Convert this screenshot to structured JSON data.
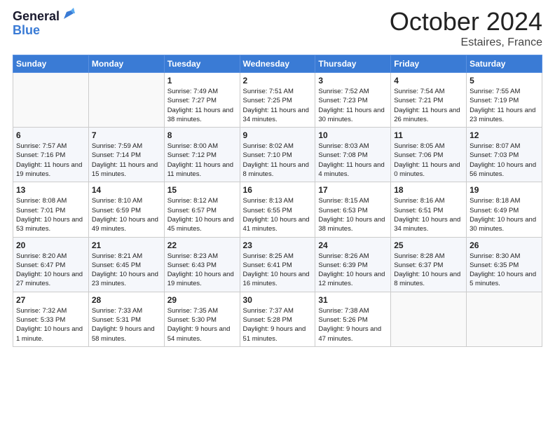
{
  "logo": {
    "general": "General",
    "blue": "Blue"
  },
  "header": {
    "month": "October 2024",
    "location": "Estaires, France"
  },
  "weekdays": [
    "Sunday",
    "Monday",
    "Tuesday",
    "Wednesday",
    "Thursday",
    "Friday",
    "Saturday"
  ],
  "weeks": [
    [
      {
        "day": "",
        "sunrise": "",
        "sunset": "",
        "daylight": ""
      },
      {
        "day": "",
        "sunrise": "",
        "sunset": "",
        "daylight": ""
      },
      {
        "day": "1",
        "sunrise": "Sunrise: 7:49 AM",
        "sunset": "Sunset: 7:27 PM",
        "daylight": "Daylight: 11 hours and 38 minutes."
      },
      {
        "day": "2",
        "sunrise": "Sunrise: 7:51 AM",
        "sunset": "Sunset: 7:25 PM",
        "daylight": "Daylight: 11 hours and 34 minutes."
      },
      {
        "day": "3",
        "sunrise": "Sunrise: 7:52 AM",
        "sunset": "Sunset: 7:23 PM",
        "daylight": "Daylight: 11 hours and 30 minutes."
      },
      {
        "day": "4",
        "sunrise": "Sunrise: 7:54 AM",
        "sunset": "Sunset: 7:21 PM",
        "daylight": "Daylight: 11 hours and 26 minutes."
      },
      {
        "day": "5",
        "sunrise": "Sunrise: 7:55 AM",
        "sunset": "Sunset: 7:19 PM",
        "daylight": "Daylight: 11 hours and 23 minutes."
      }
    ],
    [
      {
        "day": "6",
        "sunrise": "Sunrise: 7:57 AM",
        "sunset": "Sunset: 7:16 PM",
        "daylight": "Daylight: 11 hours and 19 minutes."
      },
      {
        "day": "7",
        "sunrise": "Sunrise: 7:59 AM",
        "sunset": "Sunset: 7:14 PM",
        "daylight": "Daylight: 11 hours and 15 minutes."
      },
      {
        "day": "8",
        "sunrise": "Sunrise: 8:00 AM",
        "sunset": "Sunset: 7:12 PM",
        "daylight": "Daylight: 11 hours and 11 minutes."
      },
      {
        "day": "9",
        "sunrise": "Sunrise: 8:02 AM",
        "sunset": "Sunset: 7:10 PM",
        "daylight": "Daylight: 11 hours and 8 minutes."
      },
      {
        "day": "10",
        "sunrise": "Sunrise: 8:03 AM",
        "sunset": "Sunset: 7:08 PM",
        "daylight": "Daylight: 11 hours and 4 minutes."
      },
      {
        "day": "11",
        "sunrise": "Sunrise: 8:05 AM",
        "sunset": "Sunset: 7:06 PM",
        "daylight": "Daylight: 11 hours and 0 minutes."
      },
      {
        "day": "12",
        "sunrise": "Sunrise: 8:07 AM",
        "sunset": "Sunset: 7:03 PM",
        "daylight": "Daylight: 10 hours and 56 minutes."
      }
    ],
    [
      {
        "day": "13",
        "sunrise": "Sunrise: 8:08 AM",
        "sunset": "Sunset: 7:01 PM",
        "daylight": "Daylight: 10 hours and 53 minutes."
      },
      {
        "day": "14",
        "sunrise": "Sunrise: 8:10 AM",
        "sunset": "Sunset: 6:59 PM",
        "daylight": "Daylight: 10 hours and 49 minutes."
      },
      {
        "day": "15",
        "sunrise": "Sunrise: 8:12 AM",
        "sunset": "Sunset: 6:57 PM",
        "daylight": "Daylight: 10 hours and 45 minutes."
      },
      {
        "day": "16",
        "sunrise": "Sunrise: 8:13 AM",
        "sunset": "Sunset: 6:55 PM",
        "daylight": "Daylight: 10 hours and 41 minutes."
      },
      {
        "day": "17",
        "sunrise": "Sunrise: 8:15 AM",
        "sunset": "Sunset: 6:53 PM",
        "daylight": "Daylight: 10 hours and 38 minutes."
      },
      {
        "day": "18",
        "sunrise": "Sunrise: 8:16 AM",
        "sunset": "Sunset: 6:51 PM",
        "daylight": "Daylight: 10 hours and 34 minutes."
      },
      {
        "day": "19",
        "sunrise": "Sunrise: 8:18 AM",
        "sunset": "Sunset: 6:49 PM",
        "daylight": "Daylight: 10 hours and 30 minutes."
      }
    ],
    [
      {
        "day": "20",
        "sunrise": "Sunrise: 8:20 AM",
        "sunset": "Sunset: 6:47 PM",
        "daylight": "Daylight: 10 hours and 27 minutes."
      },
      {
        "day": "21",
        "sunrise": "Sunrise: 8:21 AM",
        "sunset": "Sunset: 6:45 PM",
        "daylight": "Daylight: 10 hours and 23 minutes."
      },
      {
        "day": "22",
        "sunrise": "Sunrise: 8:23 AM",
        "sunset": "Sunset: 6:43 PM",
        "daylight": "Daylight: 10 hours and 19 minutes."
      },
      {
        "day": "23",
        "sunrise": "Sunrise: 8:25 AM",
        "sunset": "Sunset: 6:41 PM",
        "daylight": "Daylight: 10 hours and 16 minutes."
      },
      {
        "day": "24",
        "sunrise": "Sunrise: 8:26 AM",
        "sunset": "Sunset: 6:39 PM",
        "daylight": "Daylight: 10 hours and 12 minutes."
      },
      {
        "day": "25",
        "sunrise": "Sunrise: 8:28 AM",
        "sunset": "Sunset: 6:37 PM",
        "daylight": "Daylight: 10 hours and 8 minutes."
      },
      {
        "day": "26",
        "sunrise": "Sunrise: 8:30 AM",
        "sunset": "Sunset: 6:35 PM",
        "daylight": "Daylight: 10 hours and 5 minutes."
      }
    ],
    [
      {
        "day": "27",
        "sunrise": "Sunrise: 7:32 AM",
        "sunset": "Sunset: 5:33 PM",
        "daylight": "Daylight: 10 hours and 1 minute."
      },
      {
        "day": "28",
        "sunrise": "Sunrise: 7:33 AM",
        "sunset": "Sunset: 5:31 PM",
        "daylight": "Daylight: 9 hours and 58 minutes."
      },
      {
        "day": "29",
        "sunrise": "Sunrise: 7:35 AM",
        "sunset": "Sunset: 5:30 PM",
        "daylight": "Daylight: 9 hours and 54 minutes."
      },
      {
        "day": "30",
        "sunrise": "Sunrise: 7:37 AM",
        "sunset": "Sunset: 5:28 PM",
        "daylight": "Daylight: 9 hours and 51 minutes."
      },
      {
        "day": "31",
        "sunrise": "Sunrise: 7:38 AM",
        "sunset": "Sunset: 5:26 PM",
        "daylight": "Daylight: 9 hours and 47 minutes."
      },
      {
        "day": "",
        "sunrise": "",
        "sunset": "",
        "daylight": ""
      },
      {
        "day": "",
        "sunrise": "",
        "sunset": "",
        "daylight": ""
      }
    ]
  ]
}
